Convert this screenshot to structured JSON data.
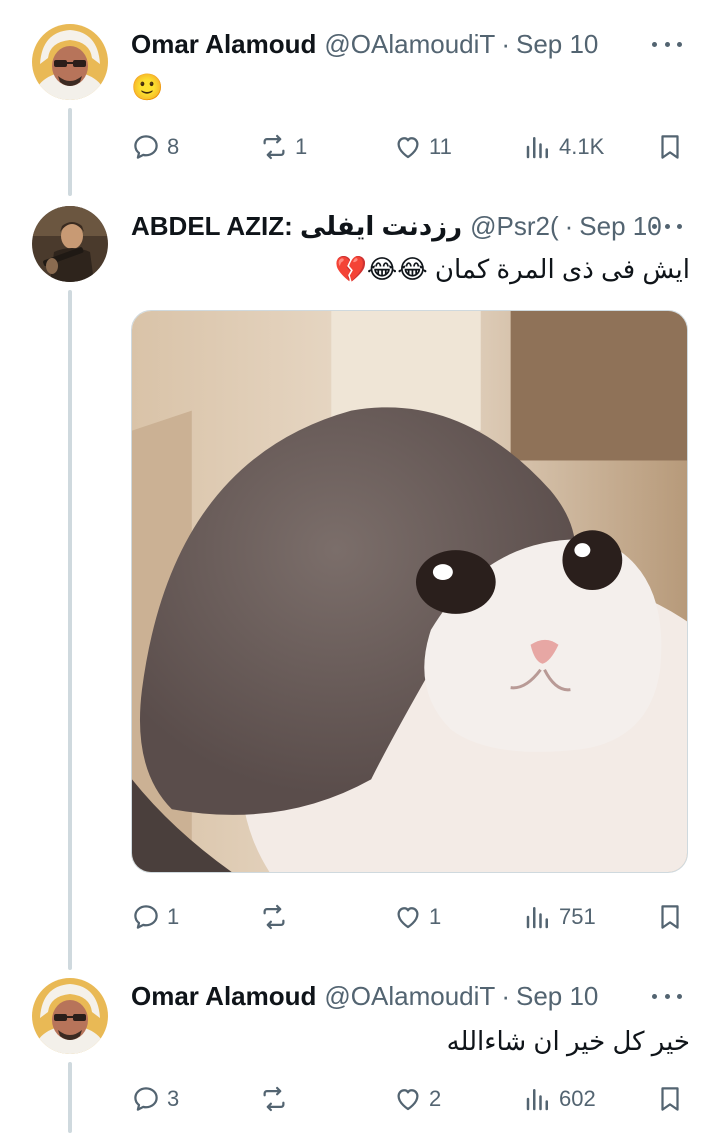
{
  "tweets": [
    {
      "name": "Omar Alamoud",
      "handle": "@OAlamoudiT",
      "sep": "·",
      "date": "Sep 10",
      "text": "🙂",
      "stats": {
        "replies": "8",
        "retweets": "1",
        "likes": "11",
        "views": "4.1K"
      }
    },
    {
      "name": "ABDEL AZIZ: رزدنت ايفلى",
      "handle": "@Psr2(",
      "sep": "·",
      "date": "Sep 10",
      "text": "ايش فى ذى المرة كمان 😂😂💔",
      "stats": {
        "replies": "1",
        "retweets": "",
        "likes": "1",
        "views": "751"
      }
    },
    {
      "name": "Omar Alamoud",
      "handle": "@OAlamoudiT",
      "sep": "·",
      "date": "Sep 10",
      "text": "خير كل خير ان شاءالله",
      "stats": {
        "replies": "3",
        "retweets": "",
        "likes": "2",
        "views": "602"
      }
    }
  ],
  "icons": {
    "reply": "reply-icon",
    "retweet": "retweet-icon",
    "like": "like-icon",
    "views": "views-icon",
    "bookmark": "bookmark-icon",
    "more": "more-icon"
  },
  "colors": {
    "text": "#0f1419",
    "muted": "#536471",
    "line": "#cfd9de"
  }
}
